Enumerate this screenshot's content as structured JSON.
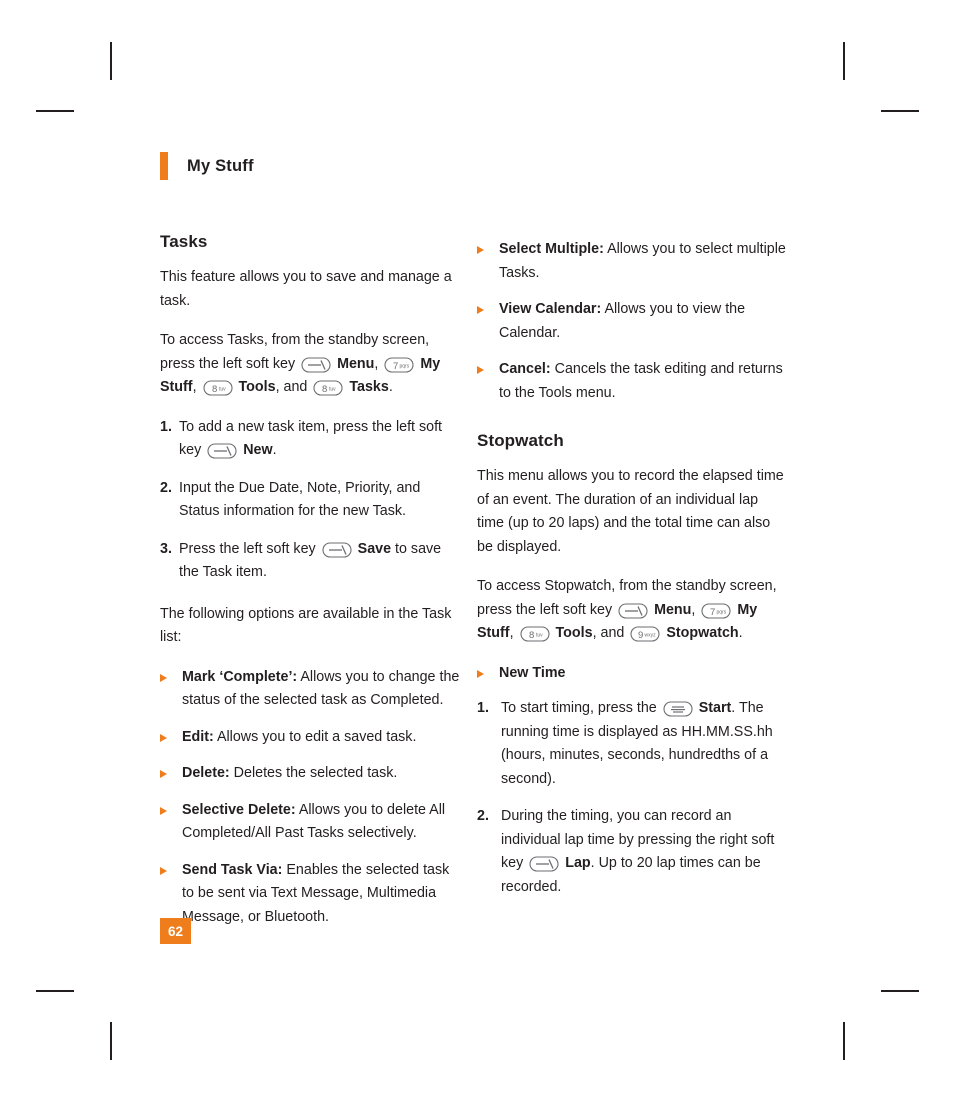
{
  "header": {
    "title": "My Stuff"
  },
  "page_number": "62",
  "left_column": {
    "section_title": "Tasks",
    "intro": "This feature allows you to save and manage a task.",
    "access_p1": "To access Tasks, from the standby screen, press the left soft key",
    "access_menu": "Menu",
    "access_comma1": ",",
    "access_mystuff": "My Stuff",
    "access_comma2": ",",
    "access_tools": "Tools",
    "access_and": ", and",
    "access_tasks": "Tasks",
    "access_period": ".",
    "steps": [
      {
        "num": "1.",
        "pre": "To add a new task item, press the left soft key",
        "bold": "New",
        "post": "."
      },
      {
        "num": "2.",
        "pre": "Input the Due Date, Note, Priority, and Status information for the new Task.",
        "bold": "",
        "post": ""
      },
      {
        "num": "3.",
        "pre": "Press the left soft key",
        "bold": "Save",
        "post": "to save the Task item."
      }
    ],
    "options_intro": "The following options are available in the Task list:",
    "options": [
      {
        "term": "Mark ‘Complete’:",
        "desc": "Allows you to change the status of the selected task as Completed."
      },
      {
        "term": "Edit:",
        "desc": "Allows you to edit a saved task."
      },
      {
        "term": "Delete:",
        "desc": "Deletes the selected task."
      },
      {
        "term": "Selective Delete:",
        "desc": "Allows you to delete All Completed/All Past Tasks selectively."
      },
      {
        "term": "Send Task Via:",
        "desc": "Enables the selected task to be sent via Text Message, Multimedia Message, or Bluetooth."
      }
    ]
  },
  "right_column": {
    "options": [
      {
        "term": "Select Multiple:",
        "desc": "Allows you to select multiple Tasks."
      },
      {
        "term": "View Calendar:",
        "desc": "Allows you to view the Calendar."
      },
      {
        "term": "Cancel:",
        "desc": "Cancels the task editing and returns to the Tools menu."
      }
    ],
    "section_title": "Stopwatch",
    "intro": "This menu allows you to record the elapsed time of an event. The duration of an individual lap time (up to 20 laps) and the total time can also be displayed.",
    "access_p1": "To access Stopwatch, from the standby screen, press the left soft key",
    "access_menu": "Menu",
    "access_comma1": ",",
    "access_mystuff": "My Stuff",
    "access_comma2": ",",
    "access_tools": "Tools",
    "access_and": ", and",
    "access_stopwatch": "Stopwatch",
    "access_period": ".",
    "new_time_label": "New Time",
    "steps": [
      {
        "num": "1.",
        "pre": "To start timing, press the",
        "bold": "Start",
        "post": ". The running time is displayed as HH.MM.SS.hh (hours, minutes, seconds, hundredths of a second)."
      },
      {
        "num": "2.",
        "pre": "During the timing, you can record an individual lap time by pressing the right soft key",
        "bold": "Lap",
        "post": ". Up to 20 lap times can be recorded."
      }
    ]
  },
  "keys": {
    "softkey": "soft-key-icon",
    "key7": "keypad-7-pqrs-icon",
    "key7_label": "7",
    "key7_sub": "pqrs",
    "key8": "keypad-8-tuv-icon",
    "key8_label": "8",
    "key8_sub": "tuv",
    "key9": "keypad-9-wxyz-icon",
    "key9_label": "9",
    "key9_sub": "wxyz",
    "okkey": "ok-center-key-icon"
  },
  "colors": {
    "accent": "#f07d1b",
    "text": "#231f20",
    "key_stroke": "#6d6e71"
  }
}
